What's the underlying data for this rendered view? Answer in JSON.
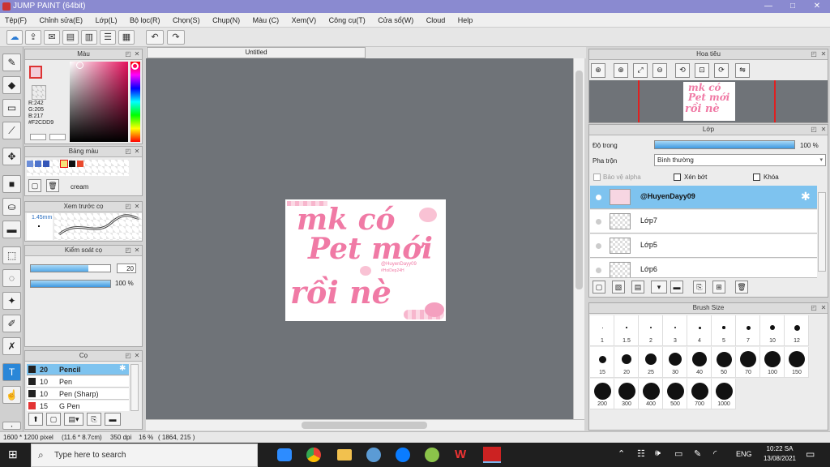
{
  "window": {
    "title": "JUMP PAINT (64bit)",
    "min": "—",
    "max": "□",
    "close": "✕"
  },
  "menu": [
    "Tệp(F)",
    "Chỉnh sửa(E)",
    "Lớp(L)",
    "Bộ lọc(R)",
    "Chọn(S)",
    "Chụp(N)",
    "Màu (C)",
    "Xem(V)",
    "Công cụ(T)",
    "Cửa sổ(W)",
    "Cloud",
    "Help"
  ],
  "panels": {
    "color": {
      "title": "Màu",
      "r": "R:242",
      "g": "G:205",
      "b": "B:217",
      "hex": "#F2CDD9"
    },
    "palette": {
      "title": "Bảng màu",
      "name": "cream"
    },
    "brush_preview": {
      "title": "Xem trước cọ",
      "size": "1.45mm"
    },
    "brush_control": {
      "title": "Kiểm soát cọ",
      "size": "20",
      "opacity": "100 %"
    },
    "brush": {
      "title": "Cọ",
      "items": [
        {
          "size": "20",
          "name": "Pencil",
          "color": "#222222"
        },
        {
          "size": "10",
          "name": "Pen",
          "color": "#222222"
        },
        {
          "size": "10",
          "name": "Pen (Sharp)",
          "color": "#222222"
        },
        {
          "size": "15",
          "name": "G Pen",
          "color": "#e33333"
        }
      ]
    },
    "navigator": {
      "title": "Hoa tiêu"
    },
    "layer": {
      "title": "Lớp",
      "opacity_label": "Độ trong",
      "opacity_value": "100 %",
      "blend_label": "Pha trộn",
      "blend_value": "Bình thường",
      "protect_alpha": "Bảo vệ alpha",
      "clipping": "Xén bớt",
      "lock": "Khóa",
      "layers": [
        "@HuyenDayy09",
        "Lớp7",
        "Lớp5",
        "Lớp6"
      ]
    },
    "brush_size": {
      "title": "Brush Size",
      "sizes": [
        "1",
        "1.5",
        "2",
        "3",
        "4",
        "5",
        "7",
        "10",
        "12",
        "15",
        "20",
        "25",
        "30",
        "40",
        "50",
        "70",
        "100",
        "150",
        "200",
        "300",
        "400",
        "500",
        "700",
        "1000"
      ]
    }
  },
  "document": {
    "tab": "Untitled",
    "art": {
      "line1": "mk có",
      "line2": "Pet mới",
      "line3": "rồi nè",
      "credit": "@HuyenDayy09",
      "credit2": "#HoiDep24H"
    }
  },
  "status": {
    "size": "1600 * 1200 pixel",
    "dims": "(11.6 * 8.7cm)",
    "dpi": "350 dpi",
    "zoom": "16 %",
    "coords": "( 1864, 215 )"
  },
  "taskbar": {
    "search_placeholder": "Type here to search",
    "lang": "ENG",
    "time": "10:22 SA",
    "date": "13/08/2021"
  },
  "colors": {
    "accent": "#8a8ad0",
    "selected": "#7ec3ef",
    "art_pink": "#f07aa5",
    "fg_color": "#F2CDD9"
  }
}
